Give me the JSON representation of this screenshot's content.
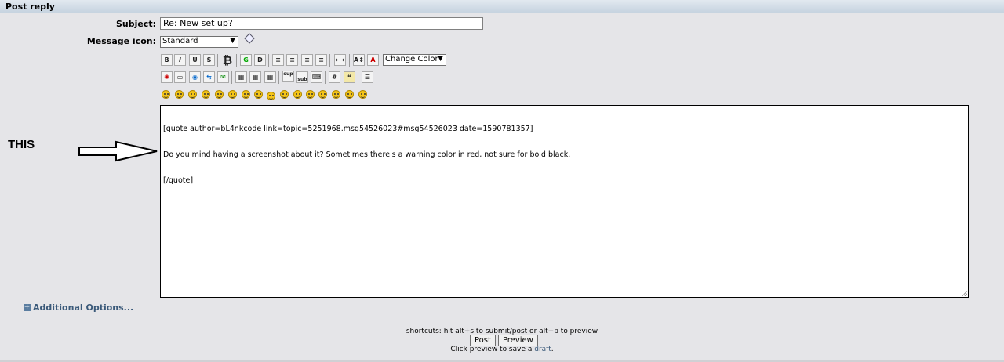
{
  "header": {
    "title": "Post reply"
  },
  "form": {
    "subject_label": "Subject:",
    "subject_value": "Re: New set up?",
    "message_icon_label": "Message icon:",
    "message_icon_value": "Standard",
    "color_select_value": "Change Color"
  },
  "toolbar": {
    "row1": [
      "bold-icon",
      "italic-icon",
      "underline-icon",
      "strikethrough-icon",
      "bitcoin-icon",
      "glow-icon",
      "shadow-icon",
      "align-left-icon",
      "align-center-icon",
      "align-right-icon",
      "justify-icon",
      "horizontal-rule-icon",
      "font-size-icon",
      "font-face-icon"
    ],
    "row2": [
      "flash-icon",
      "image-icon",
      "hyperlink-icon",
      "ftp-icon",
      "email-icon",
      "table-icon",
      "table-row-icon",
      "table-column-icon",
      "superscript-icon",
      "subscript-icon",
      "teletype-icon",
      "code-icon",
      "quote-icon",
      "list-icon"
    ],
    "row2_labels": {
      "sup": "sup",
      "sub": "sub"
    },
    "smileys_count": 16
  },
  "message": {
    "lines": [
      "[quote author=bL4nkcode link=topic=5251968.msg54526023#msg54526023 date=1590781357]",
      "Do you mind having a screenshot about it? Sometimes there's a warning color in red, not sure for bold black.",
      "[/quote]"
    ]
  },
  "annotation": {
    "text": "THIS"
  },
  "additional_options": "Additional Options...",
  "footer": {
    "shortcuts": "shortcuts: hit alt+s to submit/post or alt+p to preview",
    "post_button": "Post",
    "preview_button": "Preview",
    "draft_prefix": "Click preview to save a",
    "draft_link": "draft",
    "draft_suffix": "."
  }
}
